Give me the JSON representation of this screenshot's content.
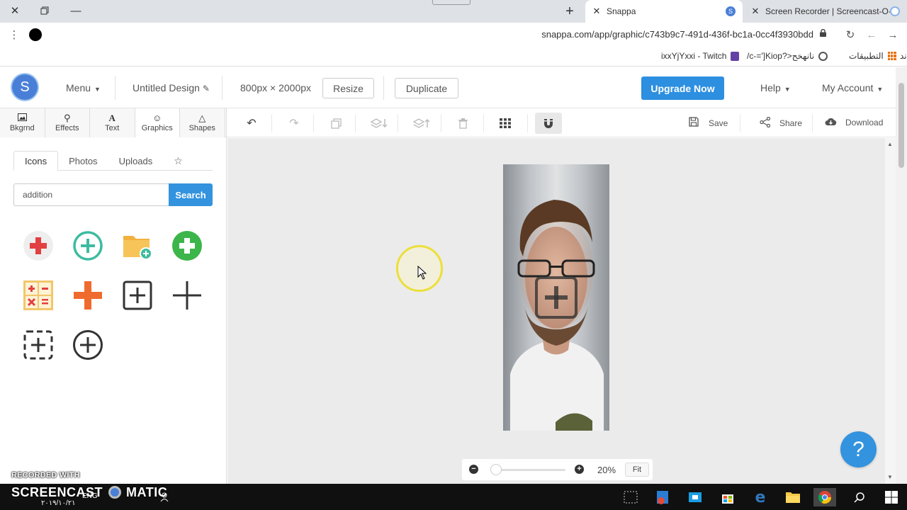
{
  "browser": {
    "tabs": [
      {
        "title": "Snappa",
        "active": true
      },
      {
        "title": "Screen Recorder | Screencast-O-",
        "active": false
      }
    ],
    "url": "snappa.com/app/graphic/c743b9c7-491d-436f-bc1a-0cc4f3930bdd",
    "bookmarks": [
      {
        "label": "ixxYjYxxi - Twitch",
        "icon": "twitch-icon"
      },
      {
        "label": "/c-=']Kiop?>نانهخح",
        "icon": "globe-icon"
      },
      {
        "label": "التطبيقات",
        "icon": "apps-grid-icon"
      }
    ],
    "bookmark_overflow": "ند"
  },
  "header": {
    "logo_letter": "S",
    "menu_label": "Menu",
    "design_title": "Untitled Design",
    "dimensions": "800px × 2000px",
    "resize_label": "Resize",
    "duplicate_label": "Duplicate",
    "upgrade_label": "Upgrade Now",
    "help_label": "Help",
    "account_label": "My Account"
  },
  "tool_tabs": [
    {
      "label": "Bkgrnd",
      "icon": "image-icon"
    },
    {
      "label": "Effects",
      "icon": "wand-icon"
    },
    {
      "label": "Text",
      "icon": "text-icon"
    },
    {
      "label": "Graphics",
      "icon": "smiley-icon"
    },
    {
      "label": "Shapes",
      "icon": "triangle-icon"
    }
  ],
  "active_tool_tab": "Graphics",
  "graphics_panel": {
    "subtabs": [
      "Icons",
      "Photos",
      "Uploads"
    ],
    "active_subtab": "Icons",
    "search_value": "addition",
    "search_button": "Search",
    "results": [
      "red-plus-circle-icon",
      "teal-plus-circle-icon",
      "folder-add-icon",
      "green-plus-circle-icon",
      "calculator-icon",
      "orange-plus-icon",
      "plus-square-icon",
      "plus-icon",
      "dashed-plus-square-icon",
      "plus-circle-outline-icon"
    ]
  },
  "toolbar": {
    "save_label": "Save",
    "share_label": "Share",
    "download_label": "Download"
  },
  "canvas": {
    "zoom_level": "20%",
    "zoom_fraction": 0.05,
    "fit_label": "Fit"
  },
  "taskbar": {
    "language": "ENG",
    "date": "٢٠١٩/١٠/٢١"
  },
  "watermark": {
    "line1": "RECORDED WITH",
    "line2": "SCREENCAST",
    "line3": "MATIC"
  },
  "colors": {
    "brand_blue": "#2d8fe0",
    "accent_green": "#3cb54a",
    "accent_orange": "#ef6b2d",
    "accent_red": "#e24040",
    "teal": "#3dbb9f"
  }
}
